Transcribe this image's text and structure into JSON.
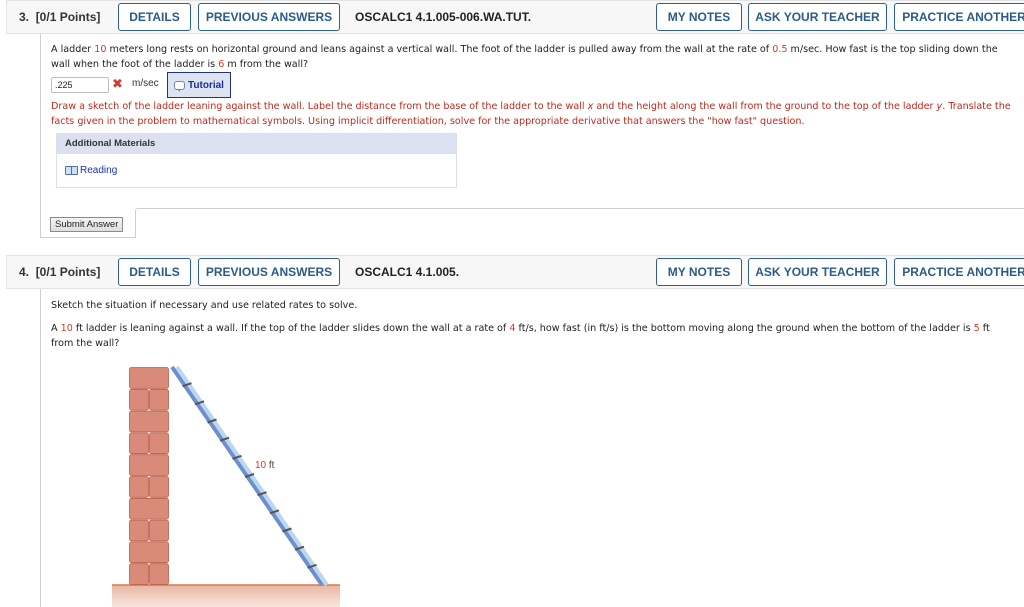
{
  "questions": [
    {
      "number": "3.",
      "points": "[0/1 Points]",
      "buttons": {
        "details": "DETAILS",
        "previous_answers": "PREVIOUS ANSWERS",
        "my_notes": "MY NOTES",
        "ask_teacher": "ASK YOUR TEACHER",
        "practice_another": "PRACTICE ANOTHER"
      },
      "code": "OSCALC1 4.1.005-006.WA.TUT.",
      "prompt": {
        "p1": "A ladder ",
        "v1": "10",
        "p2": " meters long rests on horizontal ground and leans against a vertical wall. The foot of the ladder is pulled away from the wall at the rate of ",
        "v2": "0.5",
        "p3": " m/sec. How fast is the top sliding down the",
        "p4": "wall when the foot of the ladder is ",
        "v3": "6",
        "p5": " m from the wall?"
      },
      "answer": {
        "value": ".225",
        "status": "incorrect",
        "status_icon": "x-mark-icon",
        "unit": "m/sec"
      },
      "tutorial_label": "Tutorial",
      "hint": {
        "h1": "Draw a sketch of the ladder leaning against the wall. Label the distance from the base of the ladder to the wall ",
        "x": "x",
        "h2": " and the height along the wall from the ground to the top of the ladder ",
        "y": "y",
        "h3": ". Translate the",
        "h4": "facts given in the problem to mathematical symbols. Using implicit differentiation, solve for the appropriate derivative that answers the \"how fast\" question."
      },
      "additional_materials": {
        "title": "Additional Materials",
        "items": [
          {
            "label": "Reading",
            "icon": "book-icon"
          }
        ]
      },
      "submit_label": "Submit Answer"
    },
    {
      "number": "4.",
      "points": "[0/1 Points]",
      "buttons": {
        "details": "DETAILS",
        "previous_answers": "PREVIOUS ANSWERS",
        "my_notes": "MY NOTES",
        "ask_teacher": "ASK YOUR TEACHER",
        "practice_another": "PRACTICE ANOTHER"
      },
      "code": "OSCALC1 4.1.005.",
      "instruction": "Sketch the situation if necessary and use related rates to solve.",
      "prompt": {
        "p1": "A ",
        "v1": "10",
        "p2": " ft ladder is leaning against a wall. If the top of the ladder slides down the wall at a rate of ",
        "v2": "4",
        "p3": " ft/s, how fast (in ft/s) is the bottom moving along the ground when the bottom of the ladder is ",
        "v3": "5",
        "p4": " ft",
        "p5": "from the wall?"
      },
      "figure": {
        "ladder_length_value": "10",
        "ladder_length_unit": " ft"
      }
    }
  ],
  "colors": {
    "accent": "#2b5b8a",
    "highlight_value": "#d63a26",
    "hint_text": "#c0291b",
    "link": "#1a2fb8"
  }
}
